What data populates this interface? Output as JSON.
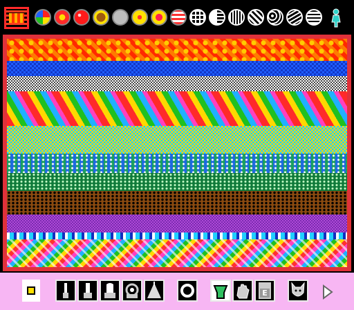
{
  "palette": {
    "items": [
      {
        "name": "pattern-current-icon"
      },
      {
        "name": "multicolor-ball-icon"
      },
      {
        "name": "red-flower-ball-icon"
      },
      {
        "name": "red-ball-icon"
      },
      {
        "name": "brown-disc-icon"
      },
      {
        "name": "grey-disc-icon"
      },
      {
        "name": "flower-icon"
      },
      {
        "name": "heart-icon"
      },
      {
        "name": "plaid-icon"
      },
      {
        "name": "grid-icon"
      },
      {
        "name": "half-grid-icon"
      },
      {
        "name": "dots-icon"
      },
      {
        "name": "diagonal-stripes-icon"
      },
      {
        "name": "swirl-icon"
      },
      {
        "name": "scribble-icon"
      },
      {
        "name": "stripes-icon"
      },
      {
        "name": "figure-icon"
      }
    ]
  },
  "toolbar": {
    "eraser_letter": "E",
    "tools": [
      "color-swatch-button",
      "thin-brush-button",
      "medium-brush-button",
      "thick-brush-button",
      "spray-can-button",
      "spotlight-button",
      "circle-stamp-button",
      "paint-fill-button",
      "clear-hand-button",
      "eraser-button",
      "dog-head-button",
      "next-page-button"
    ]
  },
  "colors": {
    "canvas_border": "#e0313a",
    "toolbar_bg": "#f7b6f3",
    "palette_bg": "#000000"
  }
}
